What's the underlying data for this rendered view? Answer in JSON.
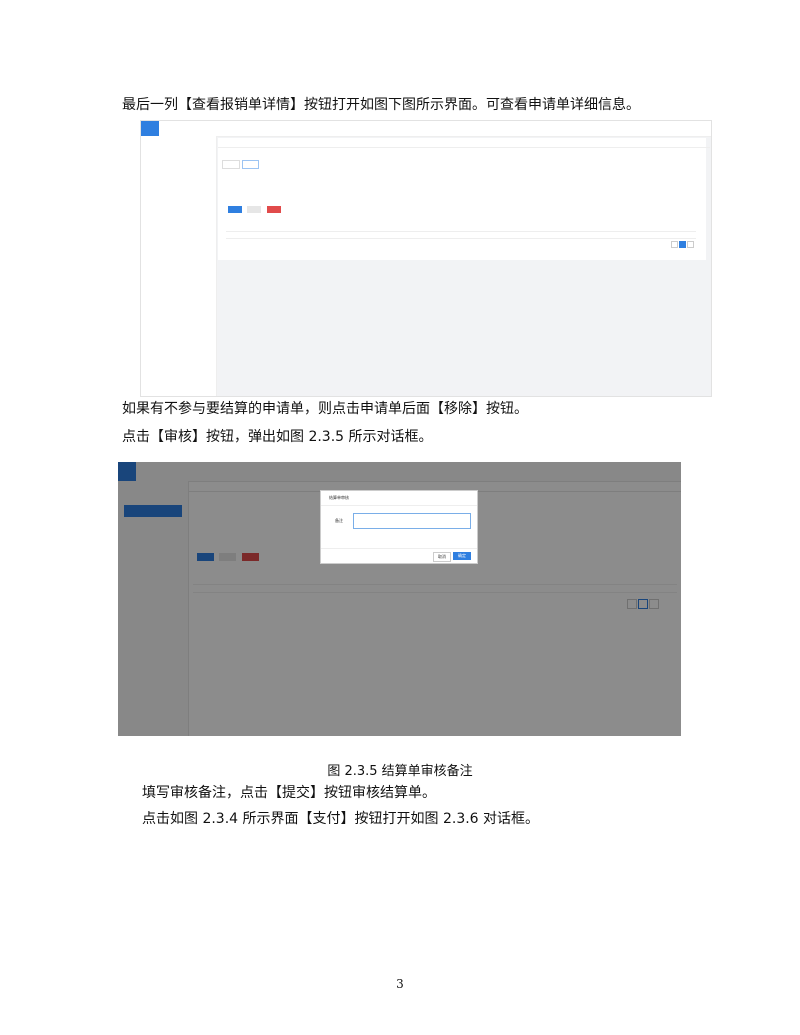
{
  "paragraphs": {
    "p1": "最后一列【查看报销单详情】按钮打开如图下图所示界面。可查看申请单详细信息。",
    "p2": "如果有不参与要结算的申请单，则点击申请单后面【移除】按钮。",
    "p3": "点击【审核】按钮，弹出如图 2.3.5 所示对话框。",
    "p4": "填写审核备注，点击【提交】按钮审核结算单。",
    "p5": "点击如图 2.3.4 所示界面【支付】按钮打开如图 2.3.6 对话框。"
  },
  "caption": "图 2.3.5  结算单审核备注",
  "page_number": "3",
  "colors": {
    "accent": "#2f7fe0",
    "brand_orange": "#e87a2c",
    "danger": "#e14b4b",
    "success": "#2f7fe0"
  },
  "dialog": {
    "title": "结算单审核",
    "field_label": "备注",
    "cancel": "取消",
    "confirm": "确定"
  }
}
